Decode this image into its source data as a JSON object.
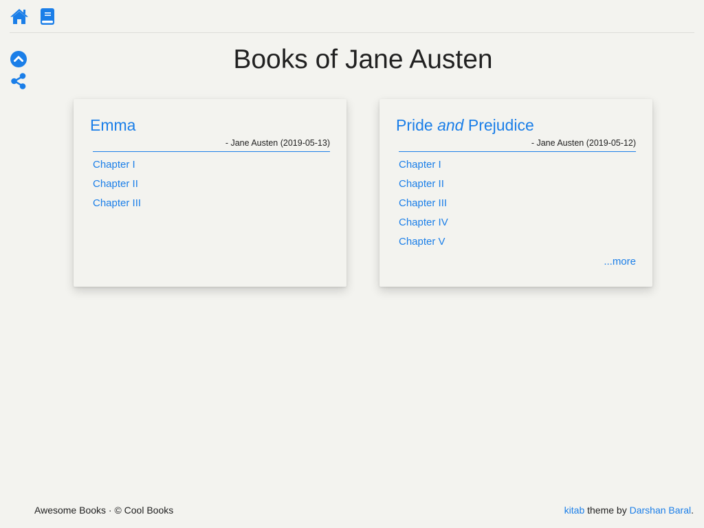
{
  "nav": {
    "home_icon": "home-icon",
    "book_icon": "book-icon",
    "accent_color": "#1a7ee8"
  },
  "side_tools": {
    "scroll_top_icon": "chevron-up-circle-icon",
    "share_icon": "share-icon"
  },
  "page": {
    "title": "Books of Jane Austen"
  },
  "books": [
    {
      "title": "Emma",
      "title_emphasis": "",
      "title_suffix": "",
      "byline": "- Jane Austen (2019-05-13)",
      "chapters": [
        "Chapter I",
        "Chapter II",
        "Chapter III"
      ]
    },
    {
      "title": "Pride",
      "title_emphasis": "and",
      "title_suffix": "Prejudice",
      "byline": "- Jane Austen (2019-05-12)",
      "chapters": [
        "Chapter I",
        "Chapter II",
        "Chapter III",
        "Chapter IV",
        "Chapter V"
      ],
      "more_label": "...more"
    }
  ],
  "footer": {
    "left_text": "Awesome Books · © Cool Books",
    "theme_link": "kitab",
    "theme_text": " theme by ",
    "author_link": "Darshan Baral",
    "end_text": "."
  }
}
